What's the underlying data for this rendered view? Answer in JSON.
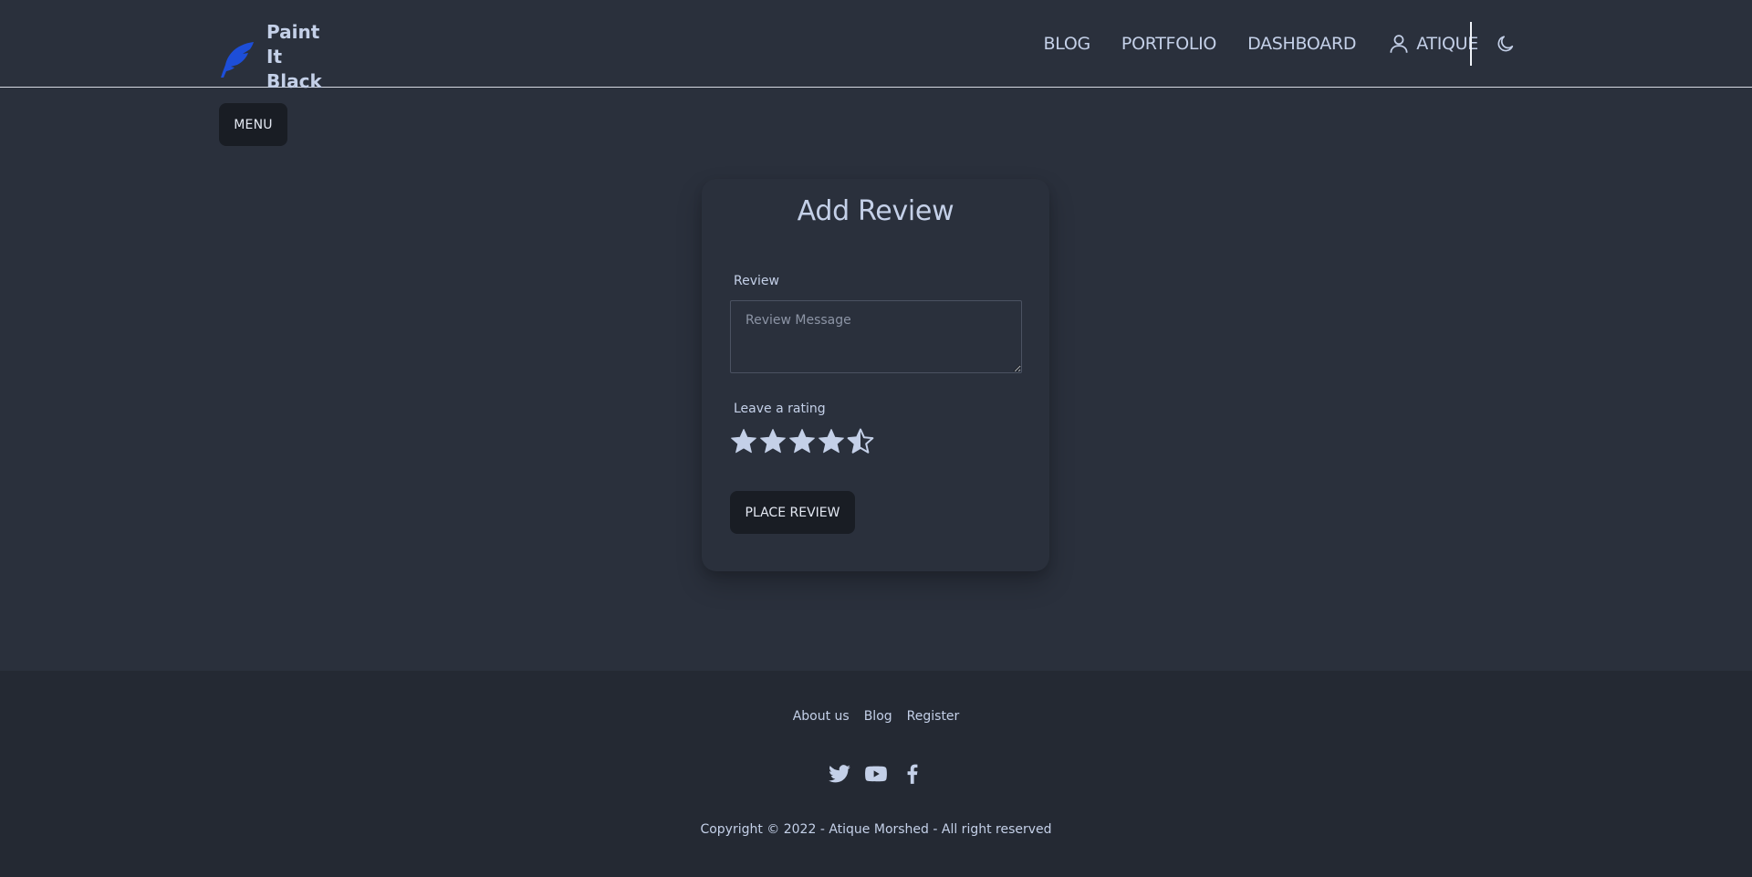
{
  "brand": {
    "name_line1": "Paint It",
    "name_line2": "Black",
    "logo_icon": "feather-icon",
    "logo_color": "#1d4ed8"
  },
  "nav": {
    "links": [
      {
        "label": "BLOG"
      },
      {
        "label": "PORTFOLIO"
      },
      {
        "label": "DASHBOARD"
      }
    ],
    "user_label": "ATIQUE",
    "user_icon": "user-icon",
    "theme_icon": "moon-icon"
  },
  "menu_button": "MENU",
  "form": {
    "title": "Add Review",
    "review_label": "Review",
    "review_placeholder": "Review Message",
    "review_value": "",
    "rating_label": "Leave a rating",
    "rating_value": 4.5,
    "rating_max": 5,
    "submit_label": "PLACE REVIEW"
  },
  "footer": {
    "links": [
      {
        "label": "About us"
      },
      {
        "label": "Blog"
      },
      {
        "label": "Register"
      }
    ],
    "social_icons": [
      "twitter-icon",
      "youtube-icon",
      "facebook-icon"
    ],
    "copyright": "Copyright © 2022 - Atique Morshed - All right reserved"
  },
  "colors": {
    "background": "#2a303c",
    "footer_background": "#242933",
    "button_background": "#191d24",
    "text": "#c4d0e8"
  }
}
